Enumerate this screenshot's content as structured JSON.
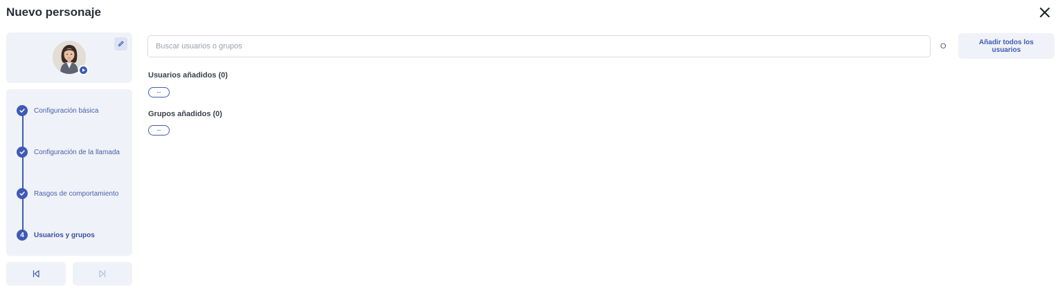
{
  "header": {
    "title": "Nuevo personaje",
    "close_icon": "close-icon"
  },
  "profile": {
    "avatar_icon": "avatar-woman",
    "play_icon": "play-icon",
    "edit_icon": "pencil-icon"
  },
  "steps": [
    {
      "label": "Configuración básica",
      "state": "done",
      "icon": "check-icon"
    },
    {
      "label": "Configuración de la llamada",
      "state": "done",
      "icon": "check-icon"
    },
    {
      "label": "Rasgos de comportamiento",
      "state": "done",
      "icon": "check-icon"
    },
    {
      "label": "Usuarios y grupos",
      "state": "active",
      "number": "4"
    }
  ],
  "navigation": {
    "prev_icon": "skip-previous-icon",
    "next_icon": "skip-next-icon"
  },
  "search": {
    "placeholder": "Buscar usuarios o grupos",
    "value": ""
  },
  "or_text": "O",
  "add_all_label": "Añadir todos los usuarios",
  "users_section": {
    "label": "Usuarios añadidos (0)",
    "chip": "--"
  },
  "groups_section": {
    "label": "Grupos añadidos (0)",
    "chip": "--"
  },
  "colors": {
    "accent": "#3f5ab4",
    "panel_bg": "#eff2f8",
    "title_text": "#2a2d36"
  }
}
